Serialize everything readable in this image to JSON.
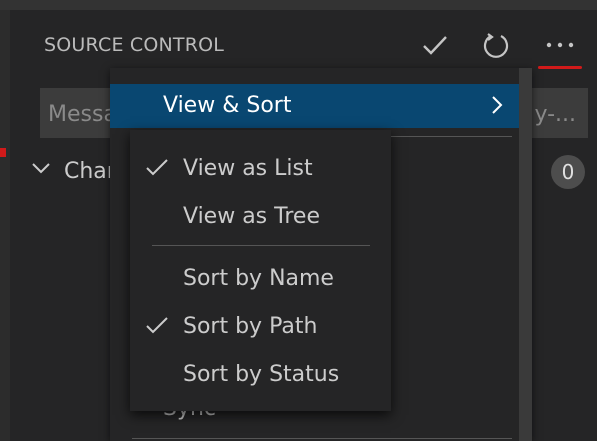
{
  "header": {
    "title": "SOURCE CONTROL",
    "commit_icon": "check-icon",
    "refresh_icon": "refresh-icon",
    "more_icon": "more-actions-icon"
  },
  "message_input": {
    "placeholder": "Messa",
    "suffix": "y-..."
  },
  "changes": {
    "label": "Char",
    "count": "0"
  },
  "menu": {
    "active_item": "View & Sort",
    "partial_item": "Sync"
  },
  "submenu": {
    "items": [
      {
        "label": "View as List",
        "checked": true
      },
      {
        "label": "View as Tree",
        "checked": false
      },
      {
        "label": "Sort by Name",
        "checked": false
      },
      {
        "label": "Sort by Path",
        "checked": true
      },
      {
        "label": "Sort by Status",
        "checked": false
      }
    ]
  },
  "colors": {
    "background": "#252526",
    "highlight": "#094771",
    "accent_underline": "#d11a1a",
    "input": "#3c3c3c"
  }
}
